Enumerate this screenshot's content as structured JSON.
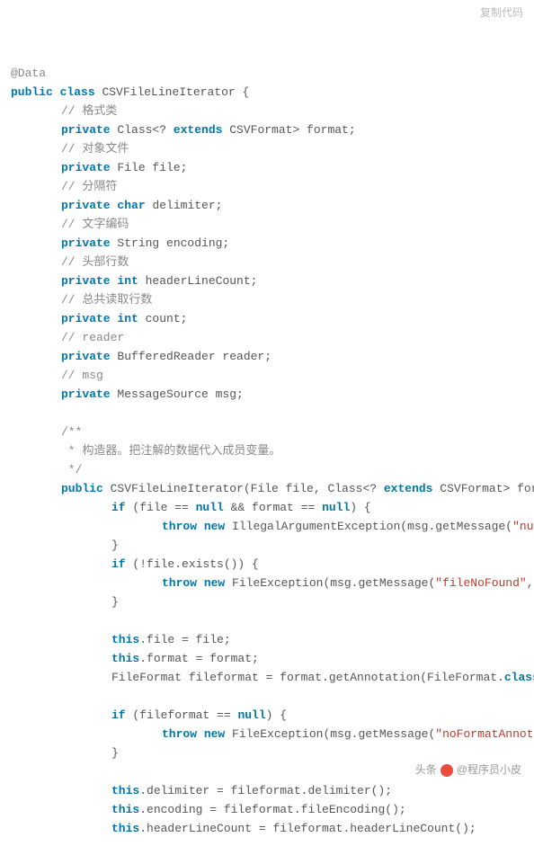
{
  "copy_label": "复制代码",
  "lines": [
    {
      "cls": "",
      "html": "<span class='ann'>@Data</span>"
    },
    {
      "cls": "",
      "html": "<span class='kw'>public</span> <span class='kw'>class</span> CSVFileLineIterator {"
    },
    {
      "cls": "i1",
      "html": "<span class='cm'>// 格式类</span>"
    },
    {
      "cls": "i1",
      "html": "<span class='kw'>private</span> Class&lt;? <span class='kw'>extends</span> CSVFormat&gt; format;"
    },
    {
      "cls": "i1",
      "html": "<span class='cm'>// 对象文件</span>"
    },
    {
      "cls": "i1",
      "html": "<span class='kw'>private</span> File file;"
    },
    {
      "cls": "i1",
      "html": "<span class='cm'>// 分隔符</span>"
    },
    {
      "cls": "i1",
      "html": "<span class='kw'>private</span> <span class='kw'>char</span> delimiter;"
    },
    {
      "cls": "i1",
      "html": "<span class='cm'>// 文字编码</span>"
    },
    {
      "cls": "i1",
      "html": "<span class='kw'>private</span> String encoding;"
    },
    {
      "cls": "i1",
      "html": "<span class='cm'>// 头部行数</span>"
    },
    {
      "cls": "i1",
      "html": "<span class='kw'>private</span> <span class='kw'>int</span> headerLineCount;"
    },
    {
      "cls": "i1",
      "html": "<span class='cm'>// 总共读取行数</span>"
    },
    {
      "cls": "i1",
      "html": "<span class='kw'>private</span> <span class='kw'>int</span> count;"
    },
    {
      "cls": "i1",
      "html": "<span class='cm'>// reader</span>"
    },
    {
      "cls": "i1",
      "html": "<span class='kw'>private</span> BufferedReader reader;"
    },
    {
      "cls": "i1",
      "html": "<span class='cm'>// msg</span>"
    },
    {
      "cls": "i1",
      "html": "<span class='kw'>private</span> MessageSource msg;"
    },
    {
      "cls": "i1",
      "html": ""
    },
    {
      "cls": "i1",
      "html": "<span class='cm'>/**</span>"
    },
    {
      "cls": "i1",
      "html": "<span class='cm'> * 构造器。把注解的数据代入成员变量。</span>"
    },
    {
      "cls": "i1",
      "html": "<span class='cm'> */</span>"
    },
    {
      "cls": "i1",
      "html": "<span class='kw'>public</span> CSVFileLineIterator(File file, Class&lt;? <span class='kw'>extends</span> CSVFormat&gt; format) throw"
    },
    {
      "cls": "i2",
      "html": "<span class='kw'>if</span> (file == <span class='kw'>null</span> &amp;&amp; format == <span class='kw'>null</span>) {"
    },
    {
      "cls": "i3",
      "html": "<span class='kw'>throw</span> <span class='kw'>new</span> IllegalArgumentException(msg.getMessage(<span class='str'>\"nullArgument</span>"
    },
    {
      "cls": "i2",
      "html": "}"
    },
    {
      "cls": "i2",
      "html": "<span class='kw'>if</span> (!file.exists()) {"
    },
    {
      "cls": "i3",
      "html": "<span class='kw'>throw</span> <span class='kw'>new</span> FileException(msg.getMessage(<span class='str'>\"fileNoFound\"</span>, <span class='kw'>null</span>, nu"
    },
    {
      "cls": "i2",
      "html": "}"
    },
    {
      "cls": "i2",
      "html": ""
    },
    {
      "cls": "i2",
      "html": "<span class='kw'>this</span>.file = file;"
    },
    {
      "cls": "i2",
      "html": "<span class='kw'>this</span>.format = format;"
    },
    {
      "cls": "i2",
      "html": "FileFormat fileformat = format.getAnnotation(FileFormat.<span class='kw'>class</span>);"
    },
    {
      "cls": "i2",
      "html": ""
    },
    {
      "cls": "i2",
      "html": "<span class='kw'>if</span> (fileformat == <span class='kw'>null</span>) {"
    },
    {
      "cls": "i3",
      "html": "<span class='kw'>throw</span> <span class='kw'>new</span> FileException(msg.getMessage(<span class='str'>\"noFormatAnnotation\"</span>, n"
    },
    {
      "cls": "i2",
      "html": "}"
    },
    {
      "cls": "i2",
      "html": ""
    },
    {
      "cls": "i2",
      "html": "<span class='kw'>this</span>.delimiter = fileformat.delimiter();"
    },
    {
      "cls": "i2",
      "html": "<span class='kw'>this</span>.encoding = fileformat.fileEncoding();"
    },
    {
      "cls": "i2",
      "html": "<span class='kw'>this</span>.headerLineCount = fileformat.headerLineCount();"
    }
  ],
  "watermark": {
    "prefix": "头条",
    "handle": "@程序员小皮"
  }
}
